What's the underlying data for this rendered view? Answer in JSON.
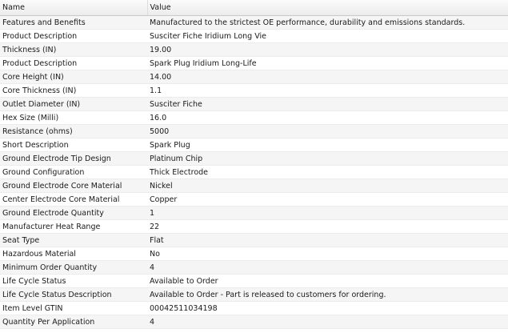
{
  "table": {
    "columns": [
      "Name",
      "Value"
    ],
    "rows": [
      [
        "Features and Benefits",
        "Manufactured to the strictest OE performance, durability and emissions standards."
      ],
      [
        "Product Description",
        "Susciter Fiche Iridium Long Vie"
      ],
      [
        "Thickness (IN)",
        "19.00"
      ],
      [
        "Product Description",
        "Spark Plug Iridium Long-Life"
      ],
      [
        "Core Height (IN)",
        "14.00"
      ],
      [
        "Core Thickness (IN)",
        "1.1"
      ],
      [
        "Outlet Diameter (IN)",
        "Susciter Fiche"
      ],
      [
        "Hex Size (Milli)",
        "16.0"
      ],
      [
        "Resistance (ohms)",
        "5000"
      ],
      [
        "Short Description",
        "Spark Plug"
      ],
      [
        "Ground Electrode Tip Design",
        "Platinum Chip"
      ],
      [
        "Ground Configuration",
        "Thick Electrode"
      ],
      [
        "Ground Electrode Core Material",
        "Nickel"
      ],
      [
        "Center Electrode Core Material",
        "Copper"
      ],
      [
        "Ground Electrode Quantity",
        "1"
      ],
      [
        "Manufacturer Heat Range",
        "22"
      ],
      [
        "Seat Type",
        "Flat"
      ],
      [
        "Hazardous Material",
        "No"
      ],
      [
        "Minimum Order Quantity",
        "4"
      ],
      [
        "Life Cycle Status",
        "Available to Order"
      ],
      [
        "Life Cycle Status Description",
        "Available to Order - Part is released to customers for ordering."
      ],
      [
        "Item Level GTIN",
        "00042511034198"
      ],
      [
        "Quantity Per Application",
        "4"
      ]
    ]
  }
}
